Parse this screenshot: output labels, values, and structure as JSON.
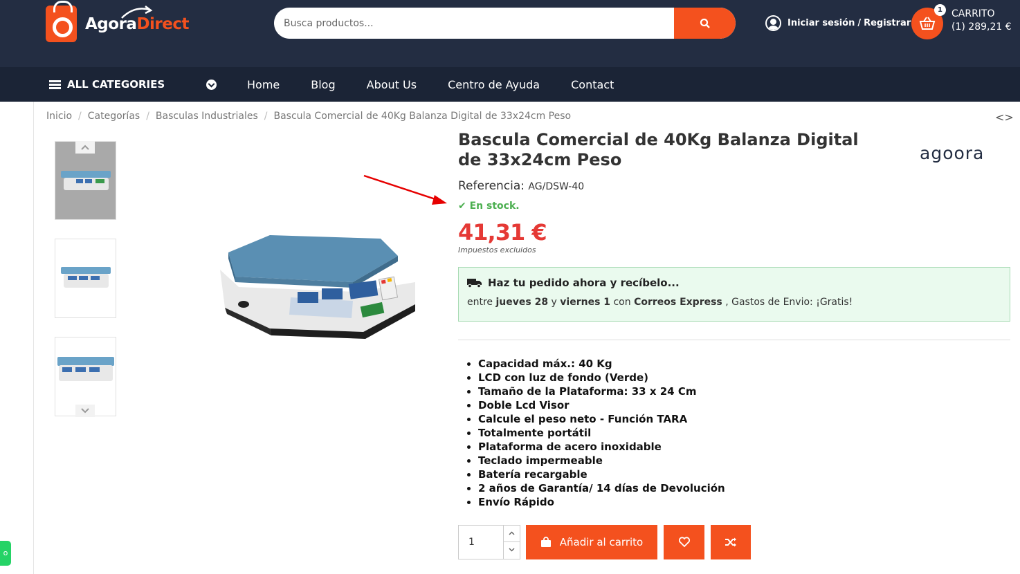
{
  "header": {
    "logo_part1": "Agora",
    "logo_part2": "Direct",
    "search_placeholder": "Busca productos...",
    "login_label": "Iniciar sesión",
    "separator": "/",
    "register_label": "Registrar",
    "cart_count": "1",
    "cart_title": "CARRITO",
    "cart_total": "(1) 289,21 €"
  },
  "nav": {
    "all_categories": "ALL CATEGORIES",
    "links": [
      "Home",
      "Blog",
      "About Us",
      "Centro de Ayuda",
      "Contact"
    ]
  },
  "breadcrumb": [
    "Inicio",
    "Categorías",
    "Basculas Industriales",
    "Bascula Comercial de 40Kg Balanza Digital de 33x24cm Peso"
  ],
  "pager": "<>",
  "product": {
    "title": "Bascula Comercial de 40Kg Balanza Digital de 33x24cm Peso",
    "brand": "agoora",
    "reference_label": "Referencia:",
    "reference_value": "AG/DSW-40",
    "stock": "En stock.",
    "price": "41,31 €",
    "tax_note": "Impuestos excluidos",
    "delivery_head": "Haz tu pedido ahora y recíbelo...",
    "delivery_prefix": "entre",
    "delivery_day1": "jueves 28",
    "delivery_and": "y",
    "delivery_day2": "viernes 1",
    "delivery_with": "con",
    "delivery_carrier": "Correos Express",
    "delivery_suffix": ", Gastos de Envio: ¡Gratis!",
    "features": [
      "Capacidad máx.: 40 Kg",
      "LCD con luz de fondo (Verde)",
      "Tamaño de la Plataforma: 33 x 24 Cm",
      "Doble Lcd Visor",
      "Calcule el peso neto - Función TARA",
      "Totalmente portátil",
      "Plataforma de acero inoxidable",
      "Teclado impermeable",
      "Batería recargable",
      "2 años de Garantía/ 14 días de Devolución",
      "Envío Rápido"
    ],
    "quantity": "1",
    "add_to_cart": "Añadir al carrito"
  },
  "colors": {
    "accent": "#f4511e",
    "header_bg": "#232d42",
    "price": "#e53935",
    "stock": "#4caf50"
  },
  "side_tab": "o"
}
